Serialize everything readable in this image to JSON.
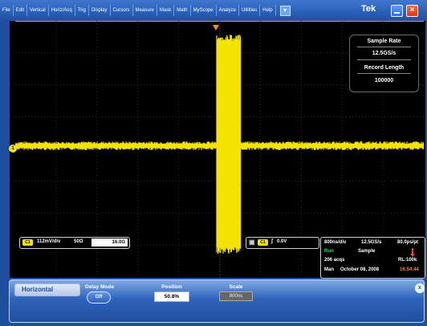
{
  "menu": {
    "items": [
      "File",
      "Edit",
      "Vertical",
      "Horiz/Acq",
      "Trig",
      "Display",
      "Cursors",
      "Measure",
      "Mask",
      "Math",
      "MyScope",
      "Analyze",
      "Utilities",
      "Help"
    ],
    "brand": "Tek"
  },
  "sample_panel": {
    "rate_label": "Sample Rate",
    "rate_value": "12.5GS/s",
    "length_label": "Record Length",
    "length_value": "100000"
  },
  "channel_readout": {
    "channel": "C1",
    "volts_per_div": "112mV/div",
    "impedance": "50Ω",
    "bandwidth": "16.0G"
  },
  "trigger_readout": {
    "channel": "C1",
    "level": "0.0V"
  },
  "status": {
    "time_per_div": "800ns/div",
    "sample_rate": "12.5GS/s",
    "pts": "80.0ps/pt",
    "state": "Run",
    "mode": "Sample",
    "acqs": "206 acqs",
    "record": "RL:100k",
    "trigger_mode": "Man",
    "date": "October 08, 2008",
    "time": "16:54:44"
  },
  "control_panel": {
    "title": "Horizontal",
    "delay_mode_label": "Delay Mode",
    "delay_mode_value": "Off",
    "position_label": "Position",
    "position_value": "50.8%",
    "scale_label": "Scale",
    "scale_value": "800ns"
  },
  "colors": {
    "trace": "#f4e300",
    "accent": "#1d4f9e",
    "run_status": "#22e84a",
    "time_status": "#ff8a2a"
  }
}
